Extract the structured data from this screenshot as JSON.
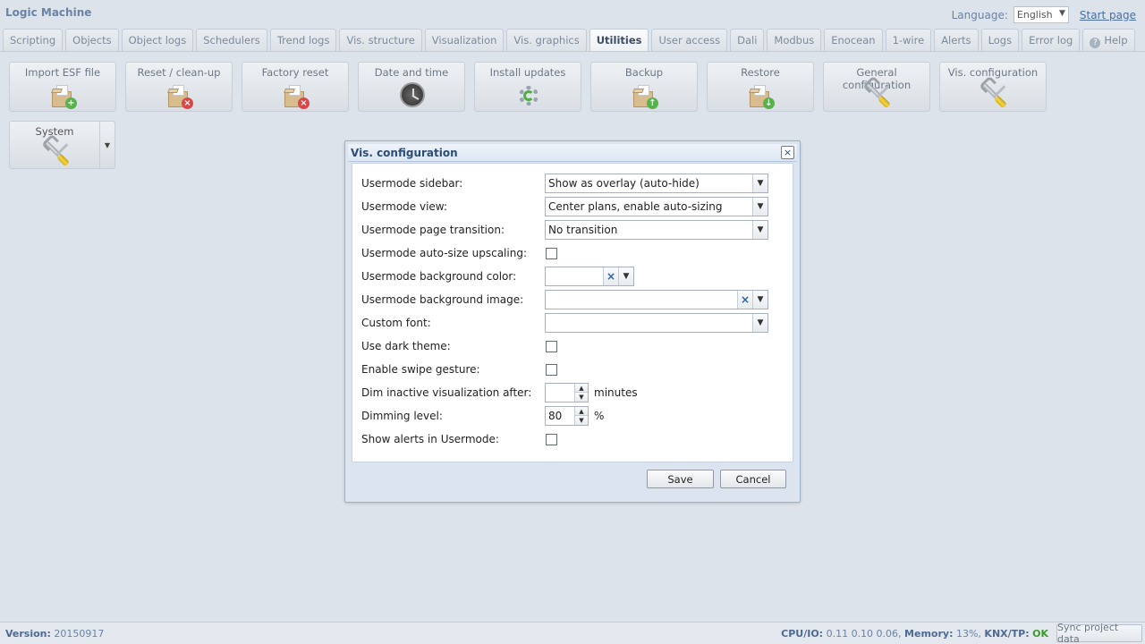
{
  "app": {
    "title": "Logic Machine",
    "language_label": "Language:",
    "language_value": "English",
    "start_page": "Start page"
  },
  "tabs": [
    {
      "label": "Scripting"
    },
    {
      "label": "Objects"
    },
    {
      "label": "Object logs"
    },
    {
      "label": "Schedulers"
    },
    {
      "label": "Trend logs"
    },
    {
      "label": "Vis. structure"
    },
    {
      "label": "Visualization"
    },
    {
      "label": "Vis. graphics"
    },
    {
      "label": "Utilities",
      "active": true
    },
    {
      "label": "User access"
    },
    {
      "label": "Dali"
    },
    {
      "label": "Modbus"
    },
    {
      "label": "Enocean"
    },
    {
      "label": "1-wire"
    },
    {
      "label": "Alerts"
    },
    {
      "label": "Logs"
    },
    {
      "label": "Error log"
    },
    {
      "label": "Help"
    }
  ],
  "tools": [
    {
      "label": "Import ESF file",
      "icon": "box-add-icon"
    },
    {
      "label": "Reset / clean-up",
      "icon": "box-remove-icon"
    },
    {
      "label": "Factory reset",
      "icon": "box-remove-icon"
    },
    {
      "label": "Date and time",
      "icon": "clock-icon"
    },
    {
      "label": "Install updates",
      "icon": "gear-update-icon"
    },
    {
      "label": "Backup",
      "icon": "box-upload-icon"
    },
    {
      "label": "Restore",
      "icon": "box-download-icon"
    },
    {
      "label": "General configuration",
      "icon": "tools-icon"
    },
    {
      "label": "Vis. configuration",
      "icon": "tools-icon"
    },
    {
      "label": "System",
      "icon": "tools-icon"
    }
  ],
  "dialog": {
    "title": "Vis. configuration",
    "fields": {
      "sidebar": {
        "label": "Usermode sidebar:",
        "value": "Show as overlay (auto-hide)"
      },
      "view": {
        "label": "Usermode view:",
        "value": "Center plans, enable auto-sizing"
      },
      "transition": {
        "label": "Usermode page transition:",
        "value": "No transition"
      },
      "upscaling": {
        "label": "Usermode auto-size upscaling:",
        "checked": false
      },
      "bg_color": {
        "label": "Usermode background color:",
        "value": ""
      },
      "bg_image": {
        "label": "Usermode background image:",
        "value": ""
      },
      "custom_font": {
        "label": "Custom font:",
        "value": ""
      },
      "dark_theme": {
        "label": "Use dark theme:",
        "checked": false
      },
      "swipe": {
        "label": "Enable swipe gesture:",
        "checked": false
      },
      "dim_after": {
        "label": "Dim inactive visualization after:",
        "value": "",
        "unit": "minutes"
      },
      "dim_level": {
        "label": "Dimming level:",
        "value": "80",
        "unit": "%"
      },
      "show_alerts": {
        "label": "Show alerts in Usermode:",
        "checked": false
      }
    },
    "save": "Save",
    "cancel": "Cancel"
  },
  "status": {
    "version_label": "Version:",
    "version_value": "20150917",
    "cpu_label": "CPU/IO:",
    "cpu_value": "0.11 0.10 0.06,",
    "mem_label": "Memory:",
    "mem_value": "13%,",
    "knx_label": "KNX/TP:",
    "knx_value": "OK",
    "sync": "Sync project data"
  },
  "colors": {
    "background": "#dde3ea",
    "accent": "#2b4d76",
    "ok": "#3d9a2f"
  }
}
